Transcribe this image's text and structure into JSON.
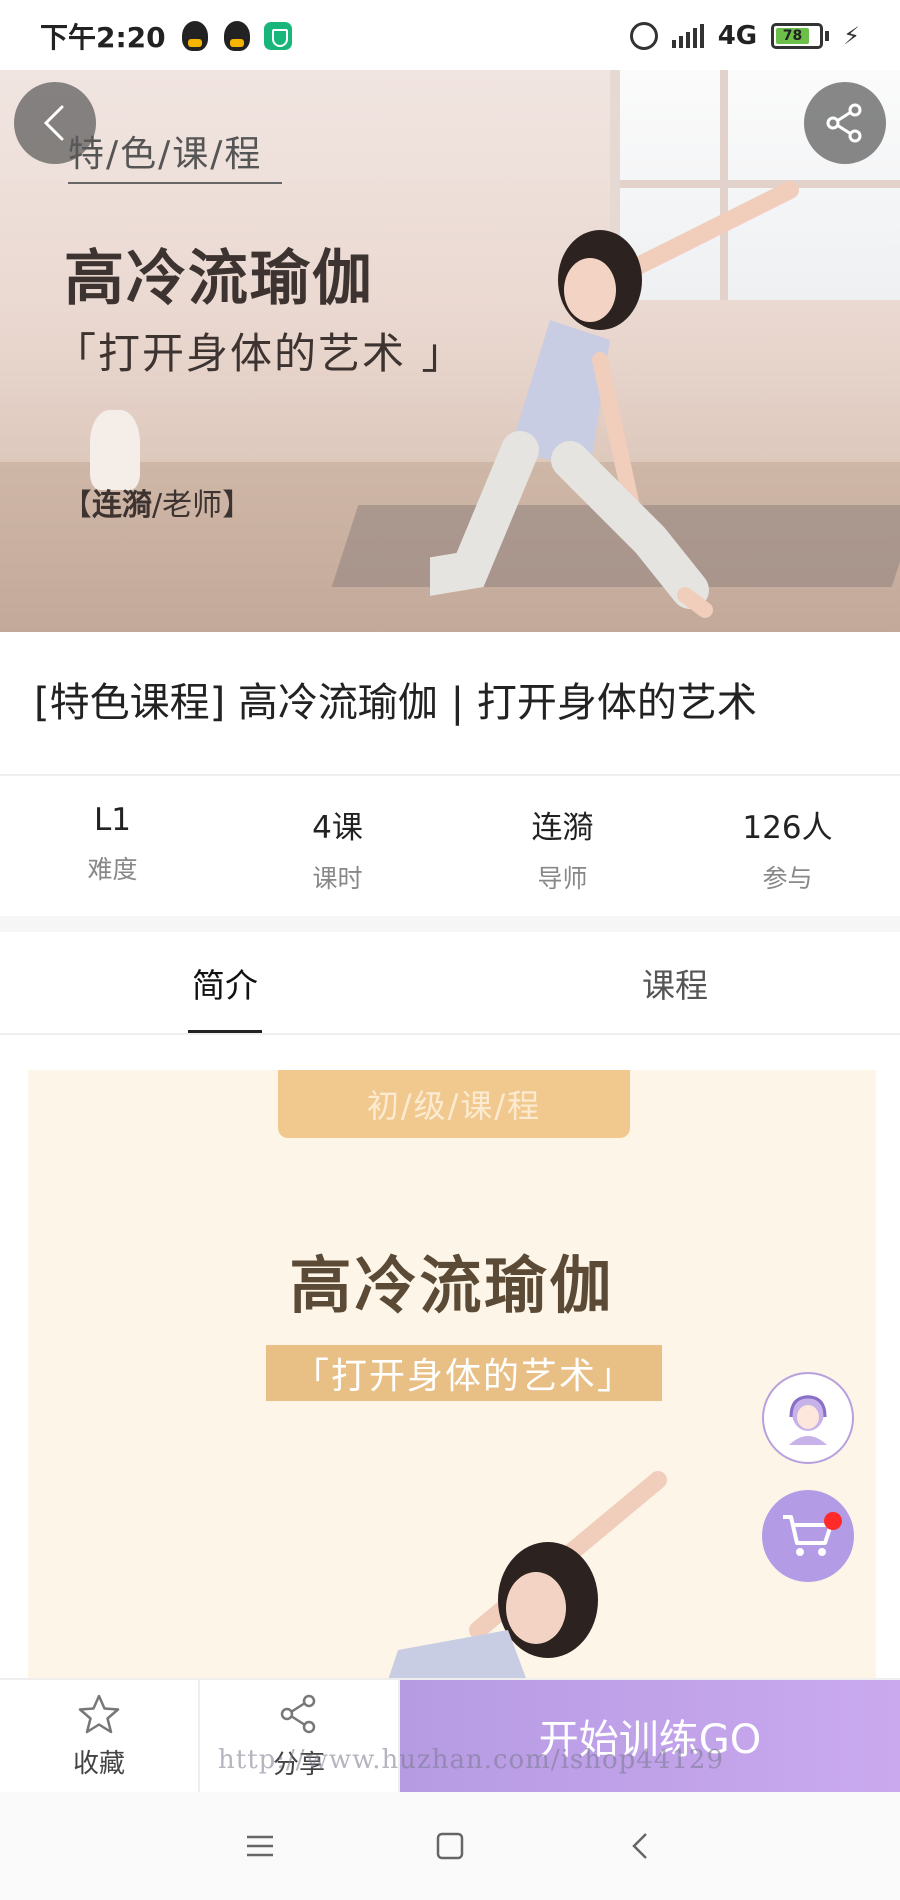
{
  "status_bar": {
    "time": "下午2:20",
    "network": "4G",
    "battery": "78"
  },
  "hero": {
    "tag": "特/色/课/程",
    "title": "高冷流瑜伽",
    "subtitle": "「打开身体的艺术 」",
    "teacher_name": "连漪",
    "teacher_suffix": "/老师】",
    "teacher_prefix": "【"
  },
  "course_title": "[特色课程] 高冷流瑜伽 | 打开身体的艺术",
  "stats": [
    {
      "value": "L1",
      "label": "难度"
    },
    {
      "value": "4课",
      "label": "课时"
    },
    {
      "value": "连漪",
      "label": "导师"
    },
    {
      "value": "126人",
      "label": "参与"
    }
  ],
  "tabs": [
    {
      "label": "简介",
      "active": true
    },
    {
      "label": "课程",
      "active": false
    }
  ],
  "poster": {
    "badge": "初/级/课/程",
    "title": "高冷流瑜伽",
    "subtitle": "「打开身体的艺术」"
  },
  "action_bar": {
    "favorite_label": "收藏",
    "share_label": "分享",
    "start_label": "开始训练GO"
  },
  "watermark": "http://www.huzhan.com/ishop44129",
  "colors": {
    "accent": "#b69be3",
    "poster_bg": "#fdf5e7",
    "badge": "#f1c98f",
    "cart_dot": "#ff2a2a"
  },
  "icons": [
    "back-icon",
    "share-icon",
    "star-icon",
    "headset-avatar-icon",
    "cart-icon",
    "menu-icon",
    "home-square-icon",
    "nav-back-icon"
  ]
}
